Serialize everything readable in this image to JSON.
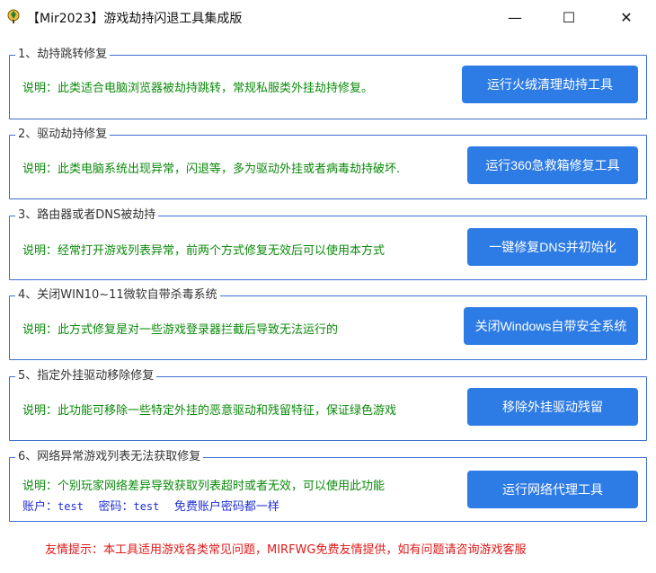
{
  "window": {
    "title": "【Mir2023】游戏劫持闪退工具集成版",
    "minimize_glyph": "—",
    "maximize_glyph": "☐",
    "close_glyph": "✕"
  },
  "groups": [
    {
      "title": "1、劫持跳转修复",
      "desc": "说明：此类适合电脑浏览器被劫持跳转，常规私服类外挂劫持修复。",
      "button": "运行火绒清理劫持工具"
    },
    {
      "title": "2、驱动劫持修复",
      "desc": "说明：此类电脑系统出现异常，闪退等，多为驱动外挂或者病毒劫持破坏.",
      "button": "运行360急救箱修复工具"
    },
    {
      "title": "3、路由器或者DNS被劫持",
      "desc": "说明：经常打开游戏列表异常，前两个方式修复无效后可以使用本方式",
      "button": "一键修复DNS并初始化"
    },
    {
      "title": "4、关闭WIN10~11微软自带杀毒系统",
      "desc": "说明：此方式修复是对一些游戏登录器拦截后导致无法运行的",
      "button": "关闭Windows自带安全系统"
    },
    {
      "title": "5、指定外挂驱动移除修复",
      "desc": "说明：此功能可移除一些特定外挂的恶意驱动和残留特征，保证绿色游戏",
      "button": "移除外挂驱动残留"
    },
    {
      "title": "6、网络异常游戏列表无法获取修复",
      "desc": "说明：个别玩家网络差异导致获取列表超时或者无效，可以使用此功能",
      "button": "运行网络代理工具",
      "account_label": "账户：",
      "account_value": "test",
      "password_label": "密码：",
      "password_value": "test",
      "account_note": "免费账户密码都一样"
    }
  ],
  "footer": {
    "tip": "友情提示：本工具适用游戏各类常见问题，MIRFWG免费友情提供，如有问题请咨询游戏客服"
  },
  "colors": {
    "accent_button": "#2d7be5",
    "group_border": "#3b6fd0",
    "desc_text": "#0a8a0a",
    "account_text": "#1f2fd6",
    "tip_text": "#e01818"
  },
  "icons": {
    "app": "game-logo-icon"
  }
}
